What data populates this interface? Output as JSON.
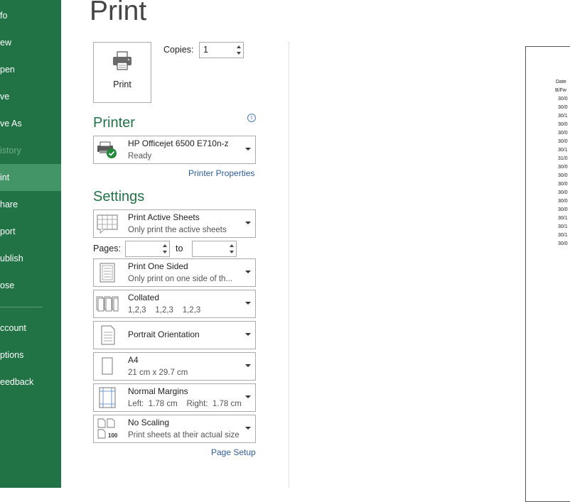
{
  "sidebar": {
    "items": [
      {
        "label": "fo",
        "state": "normal"
      },
      {
        "label": "ew",
        "state": "normal"
      },
      {
        "label": "pen",
        "state": "normal"
      },
      {
        "label": "ve",
        "state": "normal"
      },
      {
        "label": "ve As",
        "state": "normal"
      },
      {
        "label": "istory",
        "state": "disabled"
      },
      {
        "label": "int",
        "state": "active"
      },
      {
        "label": "hare",
        "state": "normal"
      },
      {
        "label": "port",
        "state": "normal"
      },
      {
        "label": "ublish",
        "state": "normal"
      },
      {
        "label": "ose",
        "state": "normal"
      }
    ],
    "bottom_items": [
      {
        "label": "ccount"
      },
      {
        "label": "ptions"
      },
      {
        "label": "eedback"
      }
    ]
  },
  "page_title": "Print",
  "print_button": {
    "label": "Print",
    "icon": "printer-icon"
  },
  "copies": {
    "label": "Copies:",
    "value": "1"
  },
  "printer": {
    "section_title": "Printer",
    "info_icon": "i",
    "name": "HP Officejet 6500 E710n-z",
    "status": "Ready",
    "properties_link": "Printer Properties"
  },
  "settings": {
    "section_title": "Settings",
    "what_to_print": {
      "title": "Print Active Sheets",
      "subtitle": "Only print the active sheets"
    },
    "pages": {
      "label": "Pages:",
      "to_label": "to",
      "from_value": "",
      "to_value": ""
    },
    "sides": {
      "title": "Print One Sided",
      "subtitle": "Only print on one side of th..."
    },
    "collation": {
      "title": "Collated",
      "subtitle": "1,2,3    1,2,3    1,2,3"
    },
    "orientation": {
      "title": "Portrait Orientation"
    },
    "paper": {
      "title": "A4",
      "subtitle": "21 cm x 29.7 cm"
    },
    "margins": {
      "title": "Normal Margins",
      "subtitle": "Left:  1.78 cm    Right:  1.78 cm"
    },
    "scaling": {
      "title": "No Scaling",
      "subtitle": "Print sheets at their actual size",
      "icon_number": "100"
    },
    "page_setup_link": "Page Setup"
  },
  "preview": {
    "header": "Date",
    "first_row": "B/Fw",
    "rows": [
      "30/0",
      "30/0",
      "30/1",
      "30/0",
      "30/0",
      "30/0",
      "30/1",
      "31/0",
      "30/0",
      "30/0",
      "30/0",
      "30/0",
      "30/0",
      "30/0",
      "30/1",
      "30/1",
      "30/1",
      "30/0"
    ]
  },
  "colors": {
    "brand_green": "#217346",
    "active_item": "#439467",
    "section_title": "#217346",
    "link": "#2e5e9e"
  }
}
